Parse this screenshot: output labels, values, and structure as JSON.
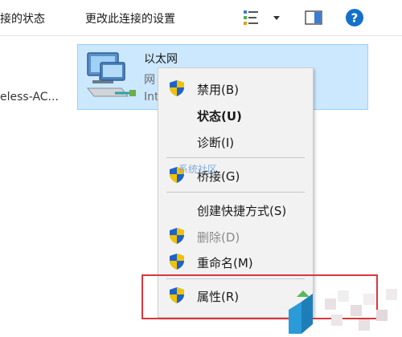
{
  "toolbar": {
    "view_status_partial": "接的状态",
    "change_settings": "更改此连接的设置"
  },
  "left_item": {
    "label_partial": "eless-AC..."
  },
  "connection": {
    "name": "以太网",
    "line2_partial": "网",
    "line3_partial": "Int"
  },
  "context_menu": {
    "items": [
      {
        "label": "禁用(B)"
      },
      {
        "label": "状态(U)"
      },
      {
        "label": "诊断(I)"
      },
      {
        "label": "桥接(G)"
      },
      {
        "label": "创建快捷方式(S)"
      },
      {
        "label": "删除(D)"
      },
      {
        "label": "重命名(M)"
      },
      {
        "label": "属性(R)"
      }
    ]
  },
  "watermark": {
    "text": "系统社区"
  },
  "colors": {
    "tile_bg": "#cce8ff",
    "menu_bg": "#f2f2f2",
    "highlight": "#d9383d",
    "help_blue": "#1570c9"
  }
}
